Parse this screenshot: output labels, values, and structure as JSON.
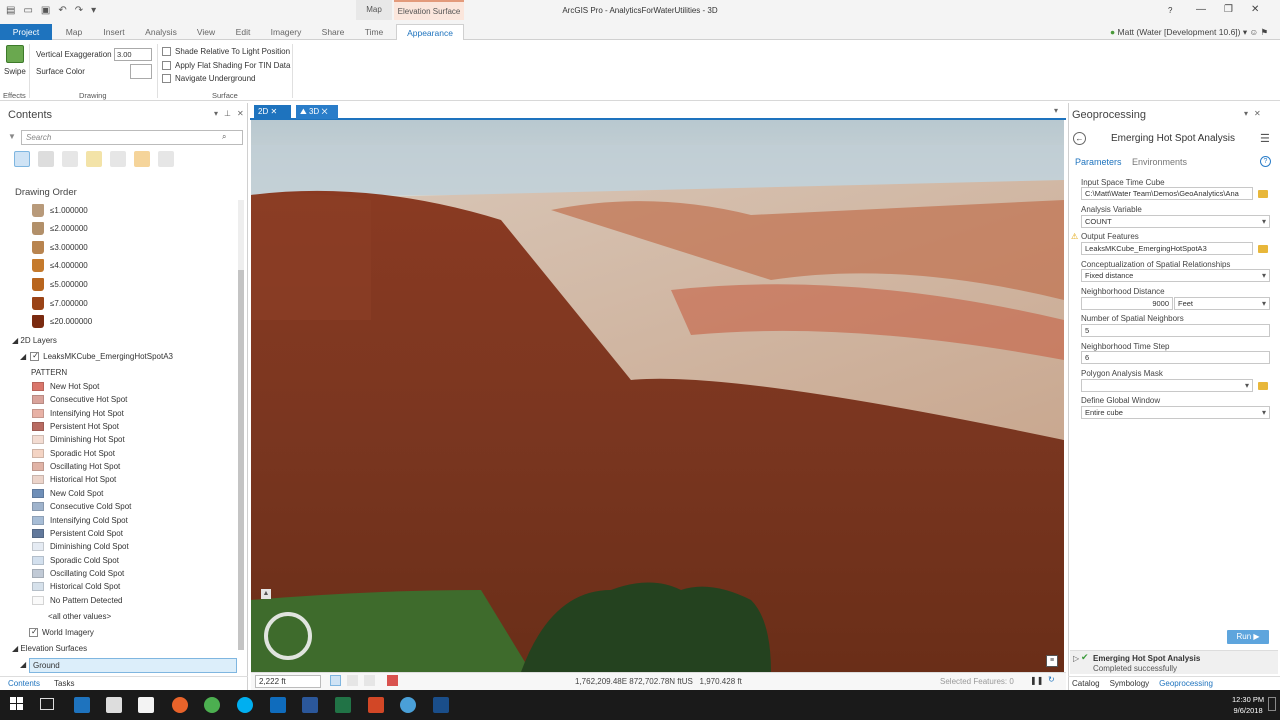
{
  "window": {
    "title": "ArcGIS Pro - AnalyticsForWaterUtilities - 3D",
    "context_tab_map": "Map",
    "context_tab_elevation": "Elevation Surface",
    "help": "?",
    "user": "Matt (Water [Development 10.6])"
  },
  "ribbon": {
    "tabs": [
      "Project",
      "Map",
      "Insert",
      "Analysis",
      "View",
      "Edit",
      "Imagery",
      "Share",
      "Time",
      "Appearance"
    ],
    "swipe_label": "Swipe",
    "vertical_exaggeration_label": "Vertical Exaggeration",
    "vertical_exaggeration_value": "3.00",
    "surface_color_label": "Surface Color",
    "checkbox_shade": "Shade Relative To Light Position",
    "checkbox_flat": "Apply Flat Shading For TIN Data",
    "checkbox_navigate": "Navigate Underground",
    "group_effects": "Effects",
    "group_drawing": "Drawing",
    "group_surface": "Surface"
  },
  "contents": {
    "title": "Contents",
    "search_placeholder": "Search",
    "drawing_order": "Drawing Order",
    "buckets": [
      {
        "label": "≤1.000000",
        "color": "#b89a7a"
      },
      {
        "label": "≤2.000000",
        "color": "#b2906a"
      },
      {
        "label": "≤3.000000",
        "color": "#b8844f"
      },
      {
        "label": "≤4.000000",
        "color": "#c57a2c"
      },
      {
        "label": "≤5.000000",
        "color": "#b8651e"
      },
      {
        "label": "≤7.000000",
        "color": "#9a4316"
      },
      {
        "label": "≤20.000000",
        "color": "#7a2a10"
      }
    ],
    "layers_2d": "2D Layers",
    "layer_name": "LeaksMKCube_EmergingHotSpotA3",
    "pattern_heading": "PATTERN",
    "patterns": [
      {
        "label": "New Hot Spot",
        "color": "#d9766b"
      },
      {
        "label": "Consecutive Hot Spot",
        "color": "#d9a39b"
      },
      {
        "label": "Intensifying Hot Spot",
        "color": "#e8b2a6"
      },
      {
        "label": "Persistent Hot Spot",
        "color": "#b86b62"
      },
      {
        "label": "Diminishing Hot Spot",
        "color": "#f3dcd2"
      },
      {
        "label": "Sporadic Hot Spot",
        "color": "#f4d4c4"
      },
      {
        "label": "Oscillating Hot Spot",
        "color": "#e0b3a6"
      },
      {
        "label": "Historical Hot Spot",
        "color": "#ecd4ca"
      },
      {
        "label": "New Cold Spot",
        "color": "#6f8fb8"
      },
      {
        "label": "Consecutive Cold Spot",
        "color": "#9fb3cc"
      },
      {
        "label": "Intensifying Cold Spot",
        "color": "#a7bdd6"
      },
      {
        "label": "Persistent Cold Spot",
        "color": "#62799c"
      },
      {
        "label": "Diminishing Cold Spot",
        "color": "#e5ebf3"
      },
      {
        "label": "Sporadic Cold Spot",
        "color": "#d3e0ee"
      },
      {
        "label": "Oscillating Cold Spot",
        "color": "#c1cad6"
      },
      {
        "label": "Historical Cold Spot",
        "color": "#d6e1eb"
      },
      {
        "label": "No Pattern Detected",
        "color": "#fafafa"
      }
    ],
    "all_other_values": "<all other values>",
    "world_imagery": "World Imagery",
    "elevation_surfaces": "Elevation Surfaces",
    "ground": "Ground",
    "bottom_tabs": [
      "Contents",
      "Tasks"
    ]
  },
  "map": {
    "tab_2d": "2D",
    "tab_3d": "3D",
    "scale": "2,222 ft",
    "coordinates": "1,762,209.48E 872,702.78N ftUS",
    "elevation": "1,970.428 ft",
    "selected_features": "Selected Features: 0"
  },
  "geoprocessing": {
    "pane_title": "Geoprocessing",
    "tool_title": "Emerging Hot Spot Analysis",
    "tab_parameters": "Parameters",
    "tab_environments": "Environments",
    "params": {
      "input_cube_label": "Input Space Time Cube",
      "input_cube_value": "C:\\Matt\\Water Team\\Demos\\GeoAnalytics\\Ana",
      "analysis_variable_label": "Analysis Variable",
      "analysis_variable_value": "COUNT",
      "output_features_label": "Output Features",
      "output_features_value": "LeaksMKCube_EmergingHotSpotA3",
      "conceptualization_label": "Conceptualization of Spatial Relationships",
      "conceptualization_value": "Fixed distance",
      "neighborhood_distance_label": "Neighborhood Distance",
      "neighborhood_distance_value": "9000",
      "neighborhood_distance_unit": "Feet",
      "spatial_neighbors_label": "Number of Spatial Neighbors",
      "spatial_neighbors_value": "5",
      "time_step_label": "Neighborhood Time Step",
      "time_step_value": "6",
      "polygon_mask_label": "Polygon Analysis Mask",
      "global_window_label": "Define Global Window",
      "global_window_value": "Entire cube"
    },
    "run_label": "Run",
    "result_title": "Emerging Hot Spot Analysis",
    "result_status": "Completed successfully",
    "bottom_tabs": [
      "Catalog",
      "Symbology",
      "Geoprocessing"
    ]
  },
  "taskbar": {
    "time": "12:30 PM",
    "date": "9/6/2018"
  }
}
